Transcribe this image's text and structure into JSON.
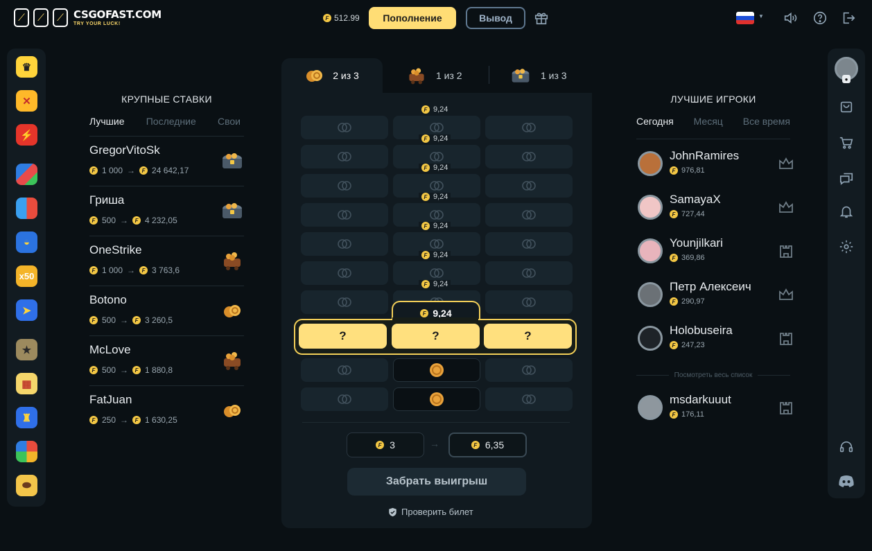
{
  "header": {
    "logo_title": "CSGOFAST.COM",
    "logo_tagline": "TRY YOUR LUCK!",
    "balance": "512.99",
    "deposit_label": "Пополнение",
    "withdraw_label": "Вывод"
  },
  "left_rail": {
    "games": [
      "crown-icon",
      "crossed-swords-icon",
      "lightning-icon",
      "colorful-blocks-icon",
      "shield-game-icon",
      "cake-icon",
      "x50-icon",
      "paper-plane-icon",
      "star-icon",
      "slot-machine-icon",
      "tower-icon",
      "wheel-icon",
      "football-icon"
    ],
    "x50_label": "x50"
  },
  "big_bets": {
    "title": "КРУПНЫЕ СТАВКИ",
    "tabs": [
      "Лучшие",
      "Последние",
      "Свои"
    ],
    "rows": [
      {
        "name": "GregorVitoSk",
        "bet": "1 000",
        "win": "24 642,17",
        "case": "chest"
      },
      {
        "name": "Гриша",
        "bet": "500",
        "win": "4 232,05",
        "case": "chest"
      },
      {
        "name": "OneStrike",
        "bet": "1 000",
        "win": "3 763,6",
        "case": "cart"
      },
      {
        "name": "Botono",
        "bet": "500",
        "win": "3 260,5",
        "case": "coins"
      },
      {
        "name": "McLove",
        "bet": "500",
        "win": "1 880,8",
        "case": "cart"
      },
      {
        "name": "FatJuan",
        "bet": "250",
        "win": "1 630,25",
        "case": "coins"
      }
    ]
  },
  "game": {
    "tabs": [
      {
        "label": "2 из 3",
        "icon": "coins-icon"
      },
      {
        "label": "1 из 2",
        "icon": "treasure-cart-icon"
      },
      {
        "label": "1 из 3",
        "icon": "treasure-chest-icon"
      }
    ],
    "multipliers": [
      "9,24",
      "9,24",
      "9,24",
      "9,24",
      "9,24",
      "9,24",
      "9,24"
    ],
    "active_multiplier": "9,24",
    "question_mark": "?",
    "bet_amount": "3",
    "win_amount": "6,35",
    "take_label": "Забрать выигрыш",
    "verify_label": "Проверить билет"
  },
  "best_players": {
    "title": "ЛУЧШИЕ ИГРОКИ",
    "tabs": [
      "Сегодня",
      "Месяц",
      "Все время"
    ],
    "rows": [
      {
        "name": "JohnRamires",
        "value": "976,81",
        "rank": "crown-rank-icon"
      },
      {
        "name": "SamayaX",
        "value": "727,44",
        "rank": "crown-rank-icon"
      },
      {
        "name": "Younjilkari",
        "value": "369,86",
        "rank": "tower-rank-icon"
      },
      {
        "name": "Петр Алексеич",
        "value": "290,97",
        "rank": "crown-rank-icon"
      },
      {
        "name": "Holobuseira",
        "value": "247,23",
        "rank": "tower-rank-icon"
      }
    ],
    "see_all": "Посмотреть весь список",
    "me": {
      "name": "msdarkuuut",
      "value": "176,11",
      "rank": "tower-rank-icon"
    }
  },
  "coin_symbol": "F",
  "colors": {
    "accent": "#ffdd75",
    "background": "#0a1014",
    "panel": "#111a20",
    "tile": "#18252d"
  }
}
